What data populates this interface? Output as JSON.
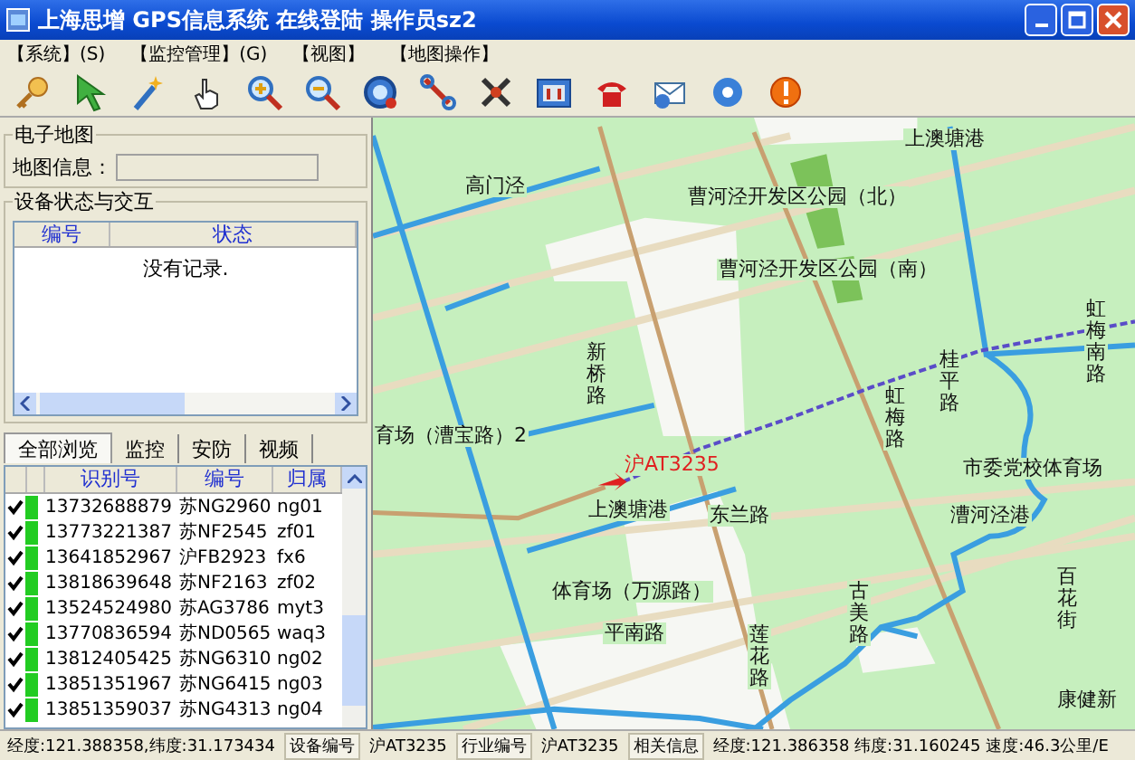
{
  "window": {
    "title": "上海思增 GPS信息系统 在线登陆 操作员sz2"
  },
  "menu": [
    "【系统】(S)",
    "【监控管理】(G)",
    "【视图】",
    "【地图操作】"
  ],
  "map_info": {
    "group_title": "电子地图",
    "label": "地图信息：",
    "disabled": true
  },
  "device_status": {
    "title": "设备状态与交互",
    "columns": [
      "编号",
      "状态"
    ],
    "empty_text": "没有记录."
  },
  "tabs": [
    {
      "label": "全部浏览",
      "selected": true
    },
    {
      "label": "监控",
      "selected": false
    },
    {
      "label": "安防",
      "selected": false
    },
    {
      "label": "视频",
      "selected": false
    }
  ],
  "vehicles": {
    "columns": [
      "识别号",
      "编号",
      "归属"
    ],
    "rows": [
      {
        "checked": true,
        "color": "#22cc22",
        "cells": [
          "13732688879",
          "苏NG2960",
          "ng01"
        ]
      },
      {
        "checked": true,
        "color": "#22cc22",
        "cells": [
          "13773221387",
          "苏NF2545",
          "zf01"
        ]
      },
      {
        "checked": true,
        "color": "#22cc22",
        "cells": [
          "13641852967",
          "沪FB2923",
          "fx6"
        ]
      },
      {
        "checked": true,
        "color": "#22cc22",
        "cells": [
          "13818639648",
          "苏NF2163",
          "zf02"
        ]
      },
      {
        "checked": true,
        "color": "#22cc22",
        "cells": [
          "13524524980",
          "苏AG3786",
          "myt3"
        ]
      },
      {
        "checked": true,
        "color": "#22cc22",
        "cells": [
          "13770836594",
          "苏ND0565",
          "waq3"
        ]
      },
      {
        "checked": true,
        "color": "#22cc22",
        "cells": [
          "13812405425",
          "苏NG6310",
          "ng02"
        ]
      },
      {
        "checked": true,
        "color": "#22cc22",
        "cells": [
          "13851351967",
          "苏NG6415",
          "ng03"
        ]
      },
      {
        "checked": true,
        "color": "#22cc22",
        "cells": [
          "13851359037",
          "苏NG4313",
          "ng04"
        ]
      }
    ]
  },
  "map": {
    "labels": [
      {
        "text": "高门泾",
        "kind": "place"
      },
      {
        "text": "曹河泾开发区公园（北）",
        "kind": "place"
      },
      {
        "text": "曹河泾开发区公园（南）",
        "kind": "place"
      },
      {
        "text": "上澳塘港",
        "kind": "place"
      },
      {
        "text": "新桥路",
        "kind": "road"
      },
      {
        "text": "育场（漕宝路）2",
        "kind": "place"
      },
      {
        "text": "沪AT3235",
        "kind": "vehicle"
      },
      {
        "text": "上澳塘港",
        "kind": "place"
      },
      {
        "text": "东兰路",
        "kind": "place"
      },
      {
        "text": "虹梅路",
        "kind": "road"
      },
      {
        "text": "桂平路",
        "kind": "road"
      },
      {
        "text": "虹梅南路",
        "kind": "road"
      },
      {
        "text": "市委党校体育场",
        "kind": "place"
      },
      {
        "text": "漕河泾港",
        "kind": "place"
      },
      {
        "text": "体育场（万源路）",
        "kind": "place"
      },
      {
        "text": "平南路",
        "kind": "place"
      },
      {
        "text": "莲花路",
        "kind": "road"
      },
      {
        "text": "古美路",
        "kind": "road"
      },
      {
        "text": "百花街",
        "kind": "road"
      },
      {
        "text": "康健新",
        "kind": "place"
      }
    ]
  },
  "status_bar": [
    {
      "text": "经度:121.388358,纬度:31.173434",
      "kind": "value"
    },
    {
      "text": "设备编号",
      "kind": "label"
    },
    {
      "text": "沪AT3235",
      "kind": "value"
    },
    {
      "text": "行业编号",
      "kind": "label"
    },
    {
      "text": "沪AT3235",
      "kind": "value"
    },
    {
      "text": "相关信息",
      "kind": "label"
    },
    {
      "text": "经度:121.386358 纬度:31.160245 速度:46.3公里/E",
      "kind": "value"
    }
  ]
}
